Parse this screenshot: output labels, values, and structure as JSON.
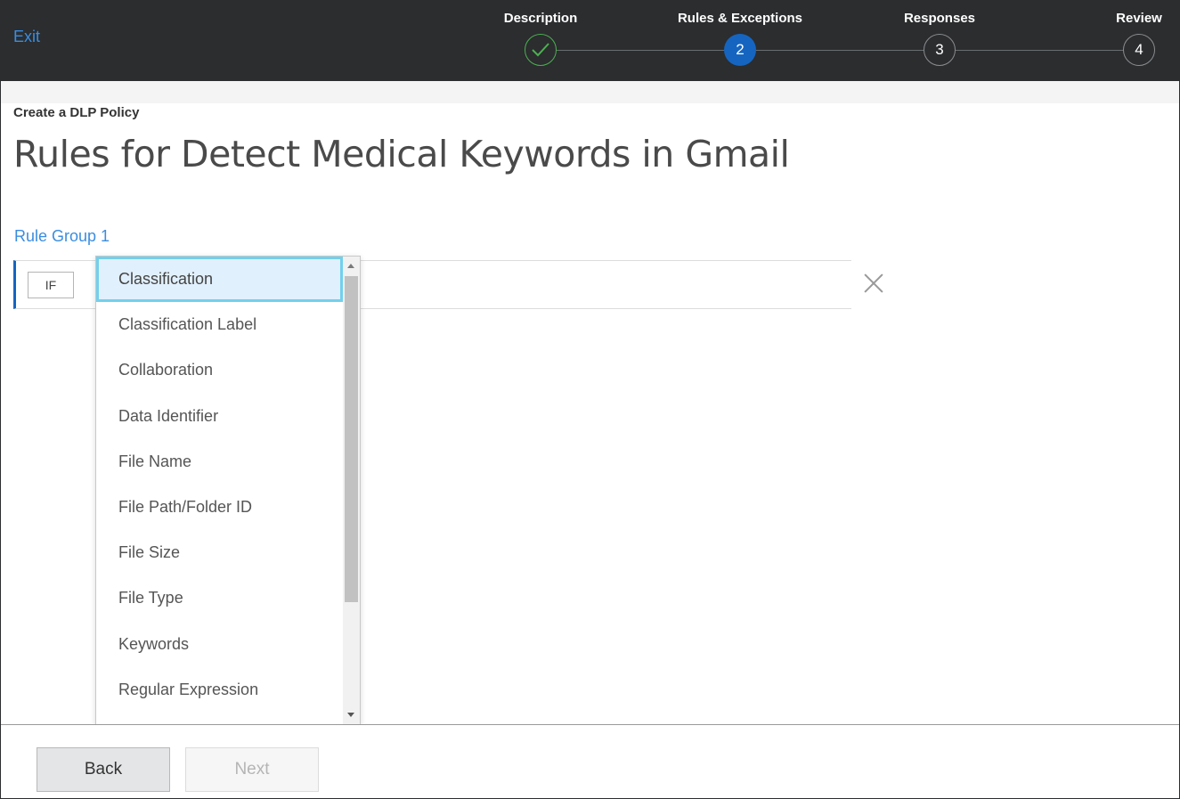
{
  "header": {
    "exit_label": "Exit",
    "steps": [
      {
        "label": "Description",
        "number": "",
        "status": "completed"
      },
      {
        "label": "Rules & Exceptions",
        "number": "2",
        "status": "active"
      },
      {
        "label": "Responses",
        "number": "3",
        "status": "pending"
      },
      {
        "label": "Review",
        "number": "4",
        "status": "pending"
      }
    ]
  },
  "page": {
    "breadcrumb": "Create a DLP Policy",
    "title": "Rules for Detect Medical Keywords in Gmail"
  },
  "rule_group": {
    "label": "Rule Group 1",
    "condition_prefix": "IF",
    "remove_icon": "close-icon"
  },
  "dropdown": {
    "selected": "Classification",
    "options": [
      "Classification",
      "Classification Label",
      "Collaboration",
      "Data Identifier",
      "File Name",
      "File Path/Folder ID",
      "File Size",
      "File Type",
      "Keywords",
      "Regular Expression"
    ]
  },
  "footer": {
    "back_label": "Back",
    "next_label": "Next",
    "next_enabled": false
  },
  "colors": {
    "header_bg": "#2b2d2f",
    "link": "#3b8de0",
    "active_step": "#1565c0",
    "completed_step": "#4cb050",
    "selected_option_bg": "#e1f0fd",
    "selected_option_border": "#72d0ec"
  }
}
